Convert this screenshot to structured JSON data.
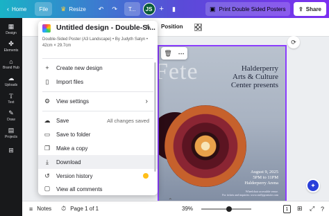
{
  "topbar": {
    "home_label": "Home",
    "file_label": "File",
    "resize_label": "Resize",
    "text_tool_label": "T...",
    "avatar_initials": "JS",
    "plus_label": "+",
    "print_label": "Print Double Sided Posters",
    "share_label": "Share"
  },
  "sidebar": {
    "items": [
      {
        "label": "Design",
        "icon": "design-icon"
      },
      {
        "label": "Elements",
        "icon": "elements-icon"
      },
      {
        "label": "Brand Hub",
        "icon": "brand-hub-icon"
      },
      {
        "label": "Uploads",
        "icon": "uploads-icon"
      },
      {
        "label": "Text",
        "icon": "text-icon"
      },
      {
        "label": "Draw",
        "icon": "draw-icon"
      },
      {
        "label": "Projects",
        "icon": "projects-icon"
      }
    ]
  },
  "context_bar": {
    "position_label": "Position"
  },
  "file_menu": {
    "title": "Untitled design - Double-Si...",
    "subtitle": "Double-Sided Poster (A3 Landscape) • By Judyth Satyn • 42cm × 29.7cm",
    "items": [
      {
        "label": "Create new design",
        "icon": "plus-icon"
      },
      {
        "label": "Import files",
        "icon": "import-file-icon"
      },
      {
        "label": "View settings",
        "icon": "settings-icon",
        "has_submenu": true
      },
      {
        "label": "Save",
        "icon": "save-cloud-icon",
        "status": "All changes saved"
      },
      {
        "label": "Save to folder",
        "icon": "folder-icon"
      },
      {
        "label": "Make a copy",
        "icon": "copy-icon"
      },
      {
        "label": "Download",
        "icon": "download-icon"
      },
      {
        "label": "Version history",
        "icon": "version-history-icon",
        "premium": true
      },
      {
        "label": "View all comments",
        "icon": "comments-icon"
      }
    ]
  },
  "poster": {
    "fete_text": "Fete",
    "org_line1": "Halderperry",
    "org_line2": "Arts & Culture",
    "org_line3": "Center presents",
    "date": "August 9, 2025",
    "time": "5PM to 11PM",
    "venue": "Halderperry Arena",
    "fine_print_1": "Wheelchair accessible venue.",
    "fine_print_2": "For tickets and inquiries: www.reallygreatsite.com"
  },
  "bottombar": {
    "notes_label": "Notes",
    "page_label": "Page 1 of 1",
    "zoom": "39%",
    "page_count": "1",
    "zoom_value": 0.39
  },
  "colors": {
    "accent_purple": "#8b3dff",
    "topbar_start": "#19b3c6",
    "topbar_end": "#7b2ff0",
    "sidebar_bg": "#18191b",
    "avatar_bg": "#0b5b3a",
    "premium_gold": "#ffbf1a"
  }
}
